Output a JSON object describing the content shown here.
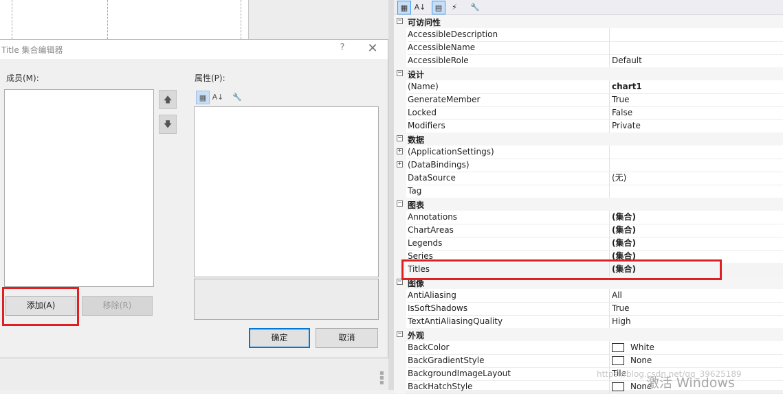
{
  "dialog": {
    "title": "Title 集合编辑器",
    "help": "?",
    "close": "✕",
    "members_label": "成员(M):",
    "properties_label": "属性(P):",
    "move_up": "🡅",
    "move_down": "🡇",
    "add_button": "添加(A)",
    "remove_button": "移除(R)",
    "ok_button": "确定",
    "cancel_button": "取消",
    "toolbar_icons": [
      "categorized-icon",
      "alphabetical-icon",
      "property-pages-icon"
    ]
  },
  "property_grid": {
    "toolbar_icons": [
      "categorized-icon",
      "alphabetical-icon",
      "properties-icon",
      "events-icon",
      "property-pages-icon"
    ],
    "rows": [
      {
        "type": "category",
        "name": "可访问性",
        "toggle": "−"
      },
      {
        "type": "prop",
        "name": "AccessibleDescription",
        "value": ""
      },
      {
        "type": "prop",
        "name": "AccessibleName",
        "value": ""
      },
      {
        "type": "prop",
        "name": "AccessibleRole",
        "value": "Default"
      },
      {
        "type": "category",
        "name": "设计",
        "toggle": "−"
      },
      {
        "type": "prop",
        "name": "(Name)",
        "value": "chart1",
        "bold": true
      },
      {
        "type": "prop",
        "name": "GenerateMember",
        "value": "True"
      },
      {
        "type": "prop",
        "name": "Locked",
        "value": "False"
      },
      {
        "type": "prop",
        "name": "Modifiers",
        "value": "Private"
      },
      {
        "type": "category",
        "name": "数据",
        "toggle": "−"
      },
      {
        "type": "prop",
        "name": "(ApplicationSettings)",
        "value": "",
        "expand": "+"
      },
      {
        "type": "prop",
        "name": "(DataBindings)",
        "value": "",
        "expand": "+"
      },
      {
        "type": "prop",
        "name": "DataSource",
        "value": "(无)"
      },
      {
        "type": "prop",
        "name": "Tag",
        "value": ""
      },
      {
        "type": "category",
        "name": "图表",
        "toggle": "−"
      },
      {
        "type": "prop",
        "name": "Annotations",
        "value": "(集合)",
        "bold": true
      },
      {
        "type": "prop",
        "name": "ChartAreas",
        "value": "(集合)",
        "bold": true
      },
      {
        "type": "prop",
        "name": "Legends",
        "value": "(集合)",
        "bold": true
      },
      {
        "type": "prop",
        "name": "Series",
        "value": "(集合)",
        "bold": true
      },
      {
        "type": "prop",
        "name": "Titles",
        "value": "(集合)",
        "bold": true,
        "selected": true
      },
      {
        "type": "category",
        "name": "图像",
        "toggle": "−"
      },
      {
        "type": "prop",
        "name": "AntiAliasing",
        "value": "All"
      },
      {
        "type": "prop",
        "name": "IsSoftShadows",
        "value": "True"
      },
      {
        "type": "prop",
        "name": "TextAntiAliasingQuality",
        "value": "High"
      },
      {
        "type": "category",
        "name": "外观",
        "toggle": "−"
      },
      {
        "type": "prop",
        "name": "BackColor",
        "value": "White",
        "swatch": "#ffffff"
      },
      {
        "type": "prop",
        "name": "BackGradientStyle",
        "value": "None",
        "swatch": "#ffffff"
      },
      {
        "type": "prop",
        "name": "BackgroundImageLayout",
        "value": "Tile"
      },
      {
        "type": "prop",
        "name": "BackHatchStyle",
        "value": "None",
        "swatch": "#ffffff"
      }
    ]
  },
  "watermark": "https://blog.csdn.net/qq_39625189",
  "activate_windows": "激活 Windows",
  "highlight_color": "#e02020"
}
